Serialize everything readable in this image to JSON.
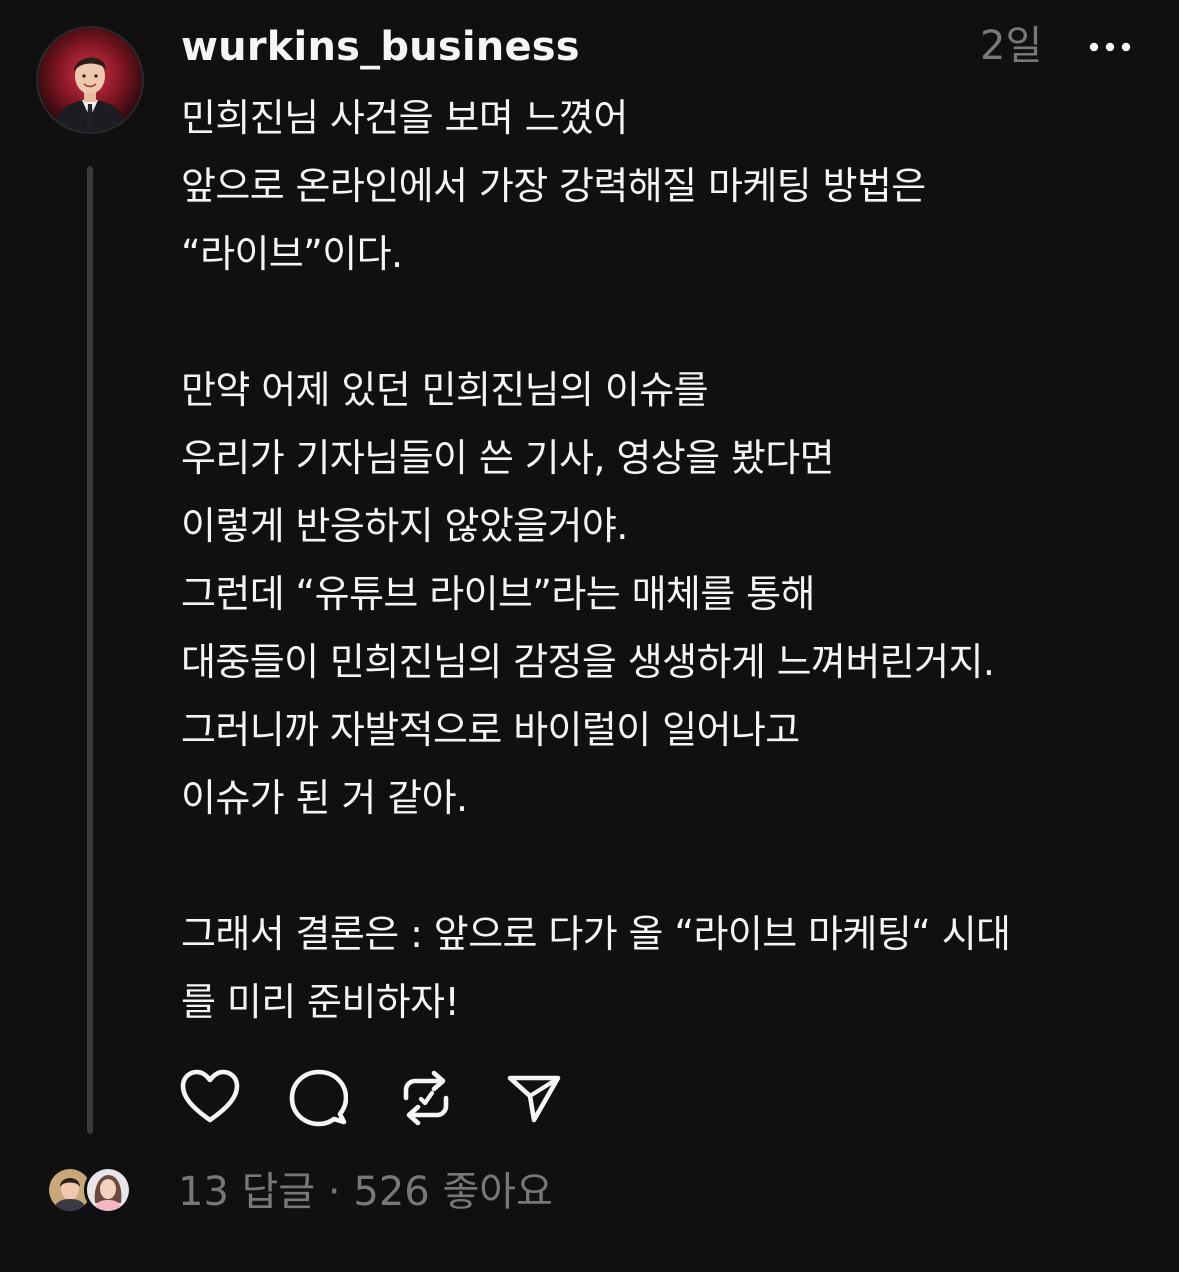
{
  "post": {
    "username": "wurkins_business",
    "time": "2일",
    "more_icon": "more-horizontal-icon",
    "body_lines": [
      "민희진님 사건을 보며 느꼈어",
      "앞으로 온라인에서 가장 강력해질 마케팅 방법은",
      "“라이브”이다.",
      "",
      "만약 어제 있던 민희진님의 이슈를",
      "우리가 기자님들이 쓴 기사, 영상을 봤다면",
      "이렇게 반응하지 않았을거야.",
      "그런데 “유튜브 라이브”라는 매체를 통해",
      "대중들이 민희진님의 감정을 생생하게 느껴버린거지.",
      "그러니까 자발적으로 바이럴이 일어나고",
      "이슈가 된 거 같아.",
      "",
      "그래서 결론은 : 앞으로 다가 올 “라이브 마케팅“ 시대",
      "를 미리 준비하자!"
    ]
  },
  "actions": {
    "like_icon": "heart-icon",
    "reply_icon": "comment-icon",
    "repost_icon": "repost-icon",
    "share_icon": "send-icon"
  },
  "footer": {
    "replies": "13 답글",
    "separator": " · ",
    "likes": "526 좋아요"
  }
}
